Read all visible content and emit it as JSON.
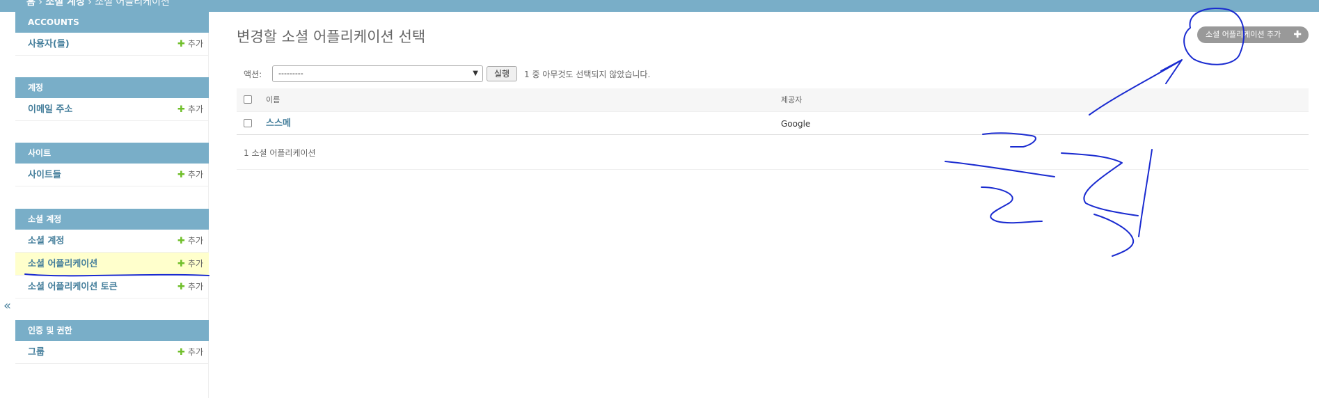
{
  "header": {
    "breadcrumb": [
      "홈",
      "소셜 계정",
      "소셜 어플리케이션"
    ]
  },
  "sidebar": {
    "add_label": "추가",
    "collapse_symbol": "«",
    "modules": [
      {
        "title": "ACCOUNTS",
        "items": [
          {
            "label": "사용자(들)"
          }
        ]
      },
      {
        "title": "계정",
        "items": [
          {
            "label": "이메일 주소"
          }
        ]
      },
      {
        "title": "사이트",
        "items": [
          {
            "label": "사이트들"
          }
        ]
      },
      {
        "title": "소셜 계정",
        "items": [
          {
            "label": "소셜 계정"
          },
          {
            "label": "소셜 어플리케이션",
            "active": true
          },
          {
            "label": "소셜 어플리케이션 토큰"
          }
        ]
      },
      {
        "title": "인증 및 권한",
        "items": [
          {
            "label": "그룹"
          }
        ]
      }
    ]
  },
  "main": {
    "title": "변경할 소셜 어플리케이션 선택",
    "add_button": "소셜 어플리케이션 추가",
    "actions": {
      "label": "액션:",
      "selected": "---------",
      "run_label": "실행",
      "counter": "1 중 아무것도 선택되지 않았습니다."
    },
    "table": {
      "columns": [
        "이름",
        "제공자"
      ],
      "rows": [
        {
          "name": "스스메",
          "provider": "Google"
        }
      ]
    },
    "paginator": "1 소셜 어플리케이션"
  },
  "annotation": {
    "handwritten_text": "클릭",
    "ink_color": "#1a2bd0"
  }
}
